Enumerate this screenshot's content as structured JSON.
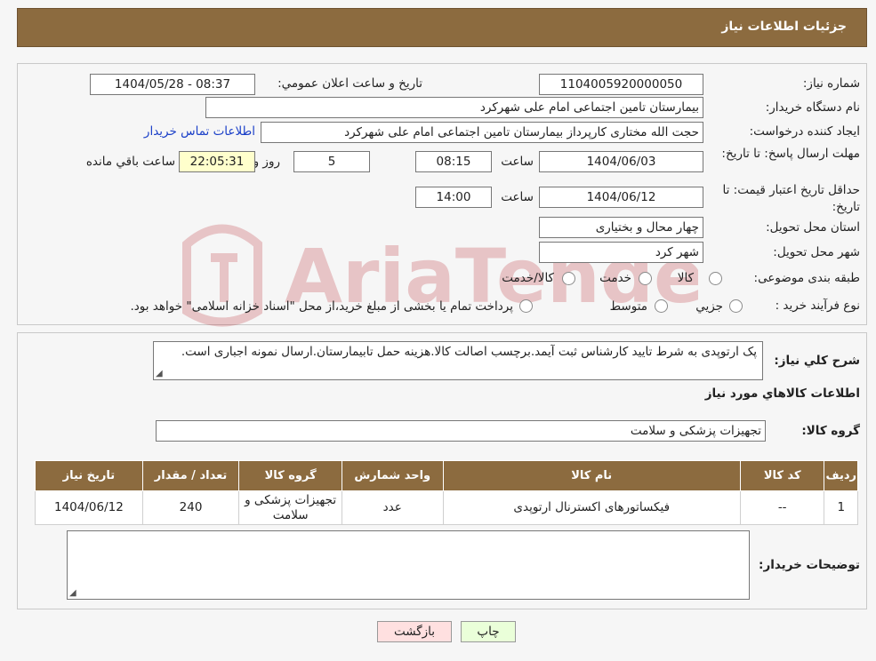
{
  "header": {
    "title": "جزئیات اطلاعات نیاز"
  },
  "form": {
    "need_number_label": "شماره نیاز:",
    "need_number": "1104005920000050",
    "announce_label": "تاریخ و ساعت اعلان عمومي:",
    "announce_value": "1404/05/28 - 08:37",
    "buyer_org_label": "نام دستگاه خریدار:",
    "buyer_org": "بیمارستان تامین اجتماعی امام علی شهرکرد",
    "creator_label": "ایجاد کننده درخواست:",
    "creator": "حجت الله مختاری کارپرداز بیمارستان تامین اجتماعی امام علی شهرکرد",
    "contact_link": "اطلاعات تماس خریدار",
    "reply_deadline_label": "مهلت ارسال پاسخ: تا تاریخ:",
    "reply_date": "1404/06/03",
    "time_label": "ساعت",
    "reply_time": "08:15",
    "days_value": "5",
    "days_label": "روز و",
    "remaining_time": "22:05:31",
    "remaining_label": "ساعت باقي مانده",
    "validity_label": "حداقل تاریخ اعتبار قیمت: تا تاریخ:",
    "validity_date": "1404/06/12",
    "validity_time": "14:00",
    "province_label": "استان محل تحویل:",
    "province": "چهار محال و بختیاری",
    "city_label": "شهر محل تحویل:",
    "city": "شهر کرد",
    "category_label": "طبقه بندی موضوعی:",
    "category_options": [
      "کالا",
      "خدمت",
      "کالا/خدمت"
    ],
    "process_label": "نوع فرآیند خرید :",
    "process_options": [
      "جزیي",
      "متوسط"
    ],
    "process_note": "پرداخت تمام یا بخشی از مبلغ خرید،از محل \"اسناد خزانه اسلامی\" خواهد بود."
  },
  "description": {
    "label": "شرح كلي نياز:",
    "text": "پک ارتوپدی به شرط تایید کارشناس ثبت آیمد.برچسب اصالت کالا.هزینه حمل تابیمارستان.ارسال نمونه اجباری است."
  },
  "goods": {
    "title": "اطلاعات كالاهاي مورد نياز",
    "group_label": "گروه کالا:",
    "group_value": "تجهیزات پزشکی و سلامت",
    "columns": [
      "ردیف",
      "کد کالا",
      "نام کالا",
      "واحد شمارش",
      "گروه کالا",
      "تعداد / مقدار",
      "تاریخ نیاز"
    ],
    "rows": [
      {
        "row": "1",
        "code": "--",
        "name": "فیکساتورهای اکسترنال ارتوپدی",
        "unit": "عدد",
        "group": "تجهیزات پزشکی و سلامت",
        "qty": "240",
        "date": "1404/06/12"
      }
    ]
  },
  "buyer_notes": {
    "label": "توضیحات خریدار:",
    "text": ""
  },
  "buttons": {
    "print": "چاپ",
    "back": "بازگشت"
  },
  "watermark": {
    "text": "AriaTender.neT"
  },
  "colors": {
    "header": "#8c6b3f",
    "link": "#1a3fc8",
    "print_bg": "#eaffd9",
    "back_bg": "#ffe0e0"
  }
}
